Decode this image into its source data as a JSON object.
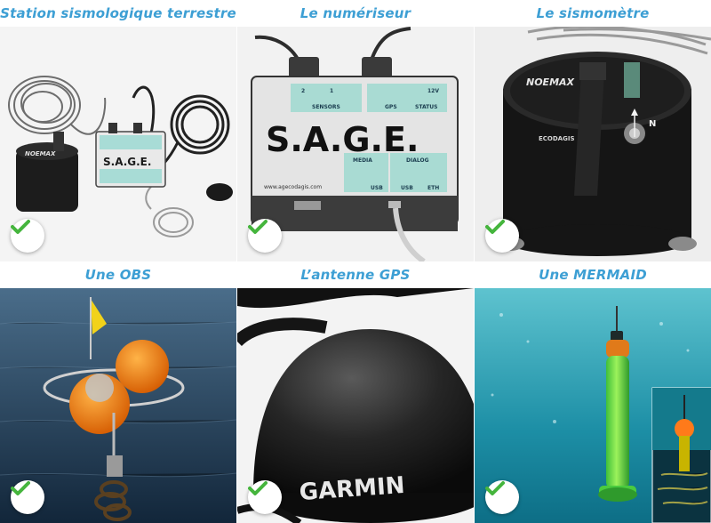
{
  "colors": {
    "caption": "#3d9fd4",
    "check_green": "#45b53d",
    "check_bg": "#ffffff"
  },
  "panels": [
    {
      "caption": "Station sismologique terrestre",
      "check_icon": "checkmark-icon",
      "logo_text": "S.A.G.E.",
      "sensor_brand": "NOEMAX"
    },
    {
      "caption": "Le numériseur",
      "check_icon": "checkmark-icon",
      "logo_text": "S.A.G.E.",
      "labels": {
        "sensors": "SENSORS",
        "gps": "GPS",
        "status": "STATUS",
        "media": "MEDIA",
        "dialog": "DIALOG",
        "usb_left": "USB",
        "usb_right": "USB",
        "eth": "ETH",
        "website": "www.agecodagis.com",
        "port1": "1",
        "port2": "2",
        "volt": "12V"
      }
    },
    {
      "caption": "Le sismomètre",
      "check_icon": "checkmark-icon",
      "brand": "NOEMAX",
      "maker": "ECODAGIS",
      "north": "N"
    },
    {
      "caption": "Une OBS",
      "check_icon": "checkmark-icon"
    },
    {
      "caption": "L’antenne GPS",
      "check_icon": "checkmark-icon",
      "brand": "GARMIN"
    },
    {
      "caption": "Une MERMAID",
      "check_icon": "checkmark-icon"
    }
  ]
}
